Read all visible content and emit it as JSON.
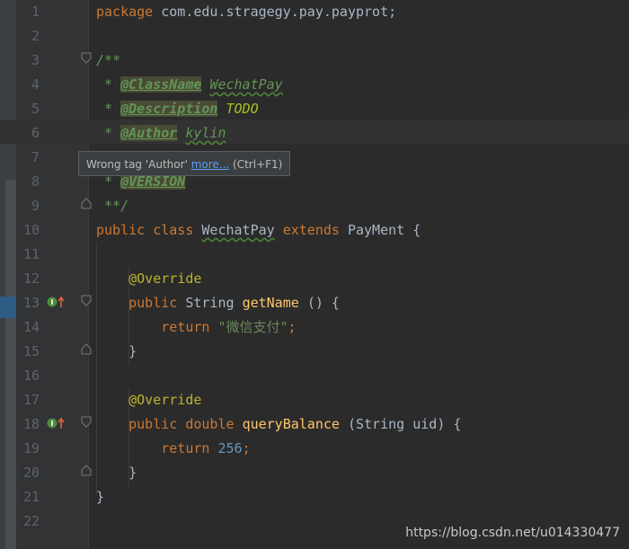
{
  "editor": {
    "lines": [
      {
        "n": "1",
        "text": "package com.edu.stragegy.pay.payprot;"
      },
      {
        "n": "2",
        "text": ""
      },
      {
        "n": "3",
        "text": "/**"
      },
      {
        "n": "4",
        "text": " * @ClassName WechatPay"
      },
      {
        "n": "5",
        "text": " * @Description TODO"
      },
      {
        "n": "6",
        "text": " * @Author kylin"
      },
      {
        "n": "7",
        "text": ""
      },
      {
        "n": "8",
        "text": " * @VERSION"
      },
      {
        "n": "9",
        "text": " **/"
      },
      {
        "n": "10",
        "text": "public class WechatPay extends PayMent {"
      },
      {
        "n": "11",
        "text": ""
      },
      {
        "n": "12",
        "text": "    @Override"
      },
      {
        "n": "13",
        "text": "    public String getName () {"
      },
      {
        "n": "14",
        "text": "        return \"微信支付\";"
      },
      {
        "n": "15",
        "text": "    }"
      },
      {
        "n": "16",
        "text": ""
      },
      {
        "n": "17",
        "text": "    @Override"
      },
      {
        "n": "18",
        "text": "    public double queryBalance (String uid) {"
      },
      {
        "n": "19",
        "text": "        return 256;"
      },
      {
        "n": "20",
        "text": "    }"
      },
      {
        "n": "21",
        "text": "}"
      },
      {
        "n": "22",
        "text": ""
      }
    ],
    "tokens": {
      "package_kw": "package",
      "package_name": " com.edu.stragegy.pay.payprot;",
      "doc_open": "/**",
      "star": " * ",
      "tag_classname": "@ClassName",
      "val_classname": "WechatPay",
      "tag_description": "@Description",
      "val_description": "TODO",
      "tag_author": "@Author",
      "val_author": "kylin",
      "tag_version": "@VERSION",
      "doc_close": " **/",
      "public_kw": "public",
      "class_kw": "class",
      "class_name": "WechatPay",
      "extends_kw": "extends",
      "parent_name": "PayMent",
      "open_brace": "{",
      "override": "@Override",
      "string_type": "String",
      "getname_fn": "getName",
      "parens": "()",
      "return_kw": "return",
      "string_literal": "\"微信支付\"",
      "semicolon": ";",
      "close_brace": "}",
      "double_kw": "double",
      "query_fn": "queryBalance",
      "param_open": "(",
      "param_type": "String",
      "param_name": "uid",
      "param_close": ")",
      "number_256": "256"
    }
  },
  "tooltip": {
    "prefix": "Wrong tag 'Author' ",
    "link": "more...",
    "shortcut": " (Ctrl+F1)"
  },
  "watermark": "https://blog.csdn.net/u014330477",
  "colors": {
    "background": "#2b2b2b",
    "keyword": "#cc7832",
    "annotation": "#bbb529",
    "function": "#ffc66d",
    "string": "#6a8759",
    "number": "#6897bb",
    "doc": "#629755"
  },
  "icons": {
    "implements_marker": "implementing-method-icon",
    "fold": "fold-marker-icon"
  }
}
